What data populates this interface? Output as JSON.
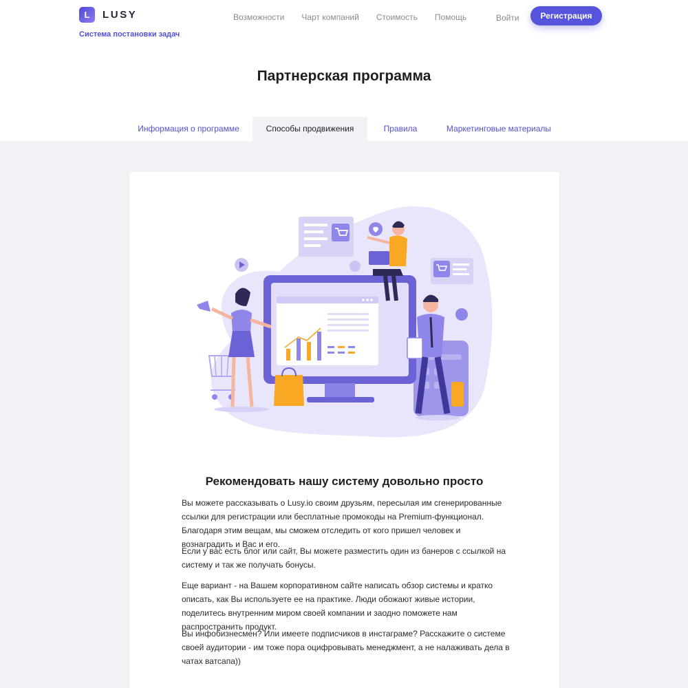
{
  "brand": {
    "logo_letter": "L",
    "name": "LUSY",
    "tagline": "Система постановки задач"
  },
  "nav": {
    "items": [
      {
        "label": "Возможности"
      },
      {
        "label": "Чарт компаний"
      },
      {
        "label": "Стоимость"
      },
      {
        "label": "Помощь"
      }
    ],
    "login_label": "Войти",
    "register_label": "Регистрация"
  },
  "page": {
    "title": "Партнерская программа"
  },
  "tabs": [
    {
      "label": "Информация о программе",
      "active": false
    },
    {
      "label": "Способы продвижения",
      "active": true
    },
    {
      "label": "Правила",
      "active": false
    },
    {
      "label": "Маркетинговые материалы",
      "active": false
    }
  ],
  "content": {
    "heading": "Рекомендовать нашу систему довольно просто",
    "paragraphs": [
      "Вы можете рассказывать о Lusy.io своим друзьям, пересылая им сгенерированные ссылки для регистрации или бесплатные промокоды на Premium-функционал. Благодаря этим вещам, мы сможем отследить от кого пришел человек и вознаградить и Вас и его.",
      "Если у вас есть блог или сайт, Вы можете разместить один из банеров с ссылкой на систему и так же получать бонусы.",
      "Еще вариант - на Вашем корпоративном сайте написать обзор системы и кратко описать, как Вы используете ее на практике. Люди обожают живые истории, поделитесь внутренним миром своей компании и заодно поможете нам распространить продукт.",
      "Вы инфобизнесмен? Или имеете подписчиков в инстаграме? Расскажите о системе своей аудитории - им тоже пора оцифровывать менеджмент, а не налаживать дела в чатах ватсапа))"
    ]
  },
  "colors": {
    "accent": "#5654dc",
    "link": "#5150d5",
    "band_bg": "#f1f2f6",
    "illustration_lavender": "#e9e6fb",
    "illustration_purple": "#6b62d6",
    "illustration_orange": "#f8a822"
  },
  "icons": [
    "logo-icon",
    "megaphone-icon",
    "cart-icon",
    "play-icon",
    "like-icon",
    "heart-icon",
    "shopping-bag-icon",
    "monitor-icon",
    "calculator-icon"
  ]
}
